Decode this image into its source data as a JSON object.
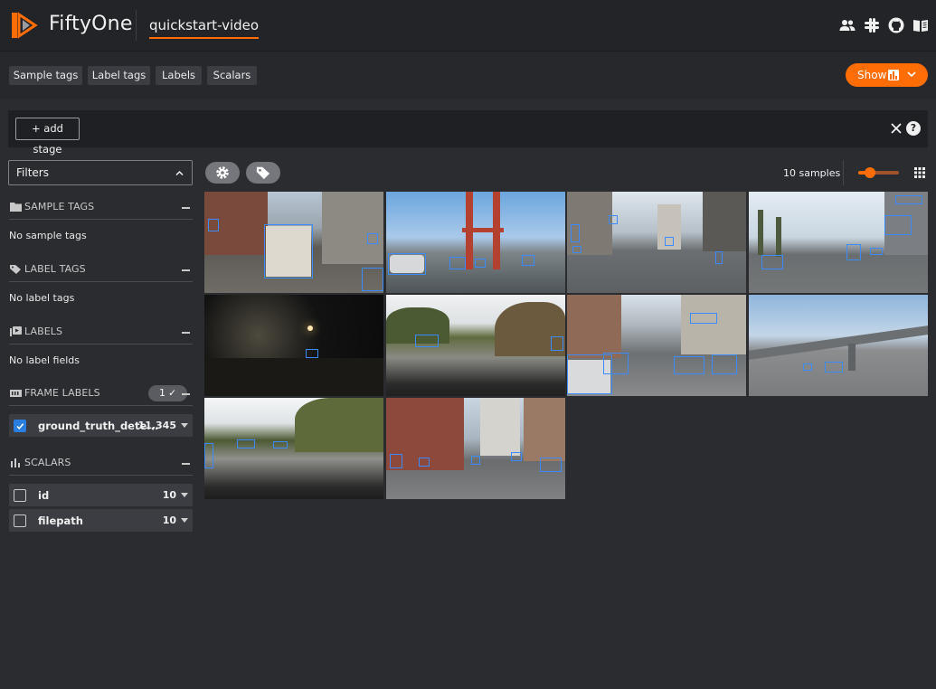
{
  "header": {
    "brand": "FiftyOne",
    "dataset": "quickstart-video",
    "icons": [
      "people-icon",
      "slack-icon",
      "github-icon",
      "book-icon"
    ]
  },
  "tabs": {
    "sample_tags": "Sample tags",
    "label_tags": "Label tags",
    "labels": "Labels",
    "scalars": "Scalars",
    "show": "Show"
  },
  "stages": {
    "add_stage": "+ add stage",
    "help": "?"
  },
  "sidebar": {
    "filters": "Filters",
    "sample_tags": {
      "title": "SAMPLE TAGS",
      "empty": "No sample tags"
    },
    "label_tags": {
      "title": "LABEL TAGS",
      "empty": "No label tags"
    },
    "labels": {
      "title": "LABELS",
      "empty": "No label fields"
    },
    "frame_labels": {
      "title": "FRAME LABELS",
      "badge": "1 ✓",
      "field": {
        "name": "ground_truth_dete...",
        "count": "11,345",
        "checked": true
      }
    },
    "scalars": {
      "title": "SCALARS",
      "fields": [
        {
          "name": "id",
          "count": "10",
          "checked": false
        },
        {
          "name": "filepath",
          "count": "10",
          "checked": false
        }
      ]
    }
  },
  "grid": {
    "sample_count": "10 samples",
    "zoom": 0.3
  },
  "colors": {
    "accent": "#ff6d04",
    "selection": "#2a7de1",
    "detection": "#3b8bff"
  }
}
